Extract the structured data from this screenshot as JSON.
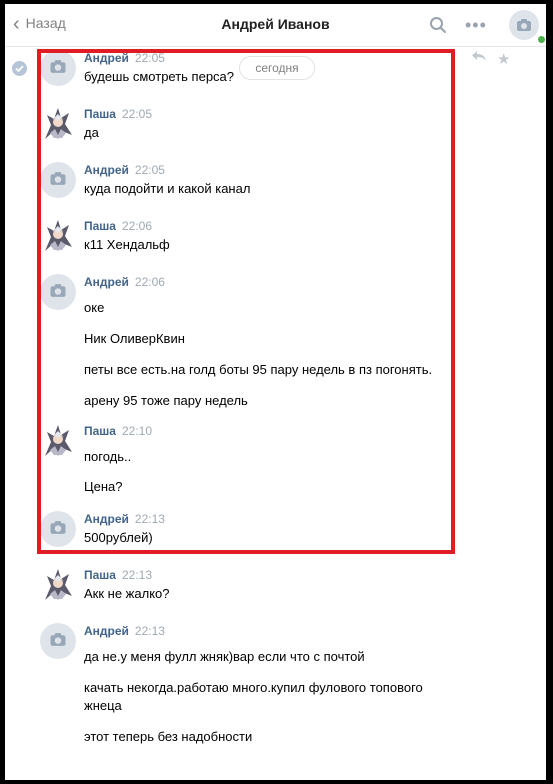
{
  "header": {
    "back_label": "Назад",
    "title": "Андрей Иванов"
  },
  "date_divider": "сегодня",
  "messages": [
    {
      "sender": "Андрей",
      "time": "22:05",
      "avatar": "camera-placeholder",
      "lines": [
        "будешь смотреть перса?"
      ]
    },
    {
      "sender": "Паша",
      "time": "22:05",
      "avatar": "anime-character",
      "lines": [
        "да"
      ]
    },
    {
      "sender": "Андрей",
      "time": "22:05",
      "avatar": "camera-placeholder",
      "lines": [
        "куда подойти и какой канал"
      ]
    },
    {
      "sender": "Паша",
      "time": "22:06",
      "avatar": "anime-character",
      "lines": [
        "к11 Хендальф"
      ]
    },
    {
      "sender": "Андрей",
      "time": "22:06",
      "avatar": "camera-placeholder",
      "lines": [
        "оке",
        "Ник ОливерКвин",
        "петы все есть.на голд боты 95 пару недель в пз погонять.",
        "арену 95 тоже пару недель"
      ]
    },
    {
      "sender": "Паша",
      "time": "22:10",
      "avatar": "anime-character",
      "lines": [
        "погодь..",
        "Цена?"
      ]
    },
    {
      "sender": "Андрей",
      "time": "22:13",
      "avatar": "camera-placeholder",
      "lines": [
        "500рублей)"
      ]
    },
    {
      "sender": "Паша",
      "time": "22:13",
      "avatar": "anime-character",
      "lines": [
        "Акк не жалко?"
      ]
    },
    {
      "sender": "Андрей",
      "time": "22:13",
      "avatar": "camera-placeholder",
      "lines": [
        "да не.у меня фулл жняк)вар если что с почтой",
        "качать некогда.работаю много.купил фулового топового",
        "жнеца",
        "этот теперь без надобности"
      ]
    }
  ],
  "colors": {
    "sender_name": "#42648b",
    "timestamp": "#a0a9b3",
    "highlight_border": "#e01c24",
    "online_dot": "#4bb34b"
  }
}
